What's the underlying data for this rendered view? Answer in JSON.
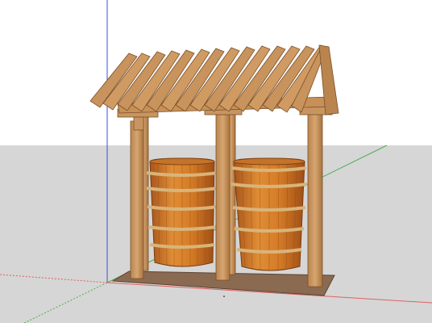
{
  "scene": {
    "description_visible": "",
    "colors": {
      "sky": "#ffffff",
      "ground": "#d9d9d9",
      "wood": "#c9935f",
      "wood_dark": "#8a5a2c",
      "barrel": "#d9822b",
      "barrel_dark": "#a8551a",
      "hoop": "#d8b47a",
      "base": "#8b6a52",
      "axis_red": "#e06060",
      "axis_green": "#4caf50",
      "axis_blue": "#3a4fd8"
    },
    "objects": [
      "wooden-pergola",
      "wooden-barrel-left",
      "wooden-barrel-right",
      "ground-plane",
      "axis-lines"
    ]
  }
}
